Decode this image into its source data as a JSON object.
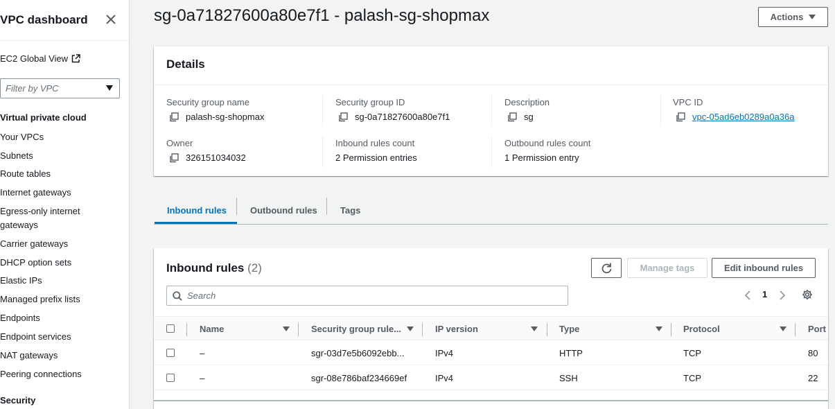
{
  "sidebar": {
    "title": "VPC dashboard",
    "global_view": "EC2 Global View",
    "filter_placeholder": "Filter by VPC",
    "section_vpc": "Virtual private cloud",
    "items": [
      "Your VPCs",
      "Subnets",
      "Route tables",
      "Internet gateways",
      "Egress-only internet gateways",
      "Carrier gateways",
      "DHCP option sets",
      "Elastic IPs",
      "Managed prefix lists",
      "Endpoints",
      "Endpoint services",
      "NAT gateways",
      "Peering connections"
    ],
    "section_security": "Security"
  },
  "header": {
    "title": "sg-0a71827600a80e7f1 - palash-sg-shopmax",
    "actions_label": "Actions"
  },
  "details": {
    "title": "Details",
    "fields": {
      "sg_name_label": "Security group name",
      "sg_name": "palash-sg-shopmax",
      "sg_id_label": "Security group ID",
      "sg_id": "sg-0a71827600a80e7f1",
      "description_label": "Description",
      "description": "sg",
      "vpc_id_label": "VPC ID",
      "vpc_id": "vpc-05ad6eb0289a0a36a",
      "owner_label": "Owner",
      "owner": "326151034032",
      "inbound_count_label": "Inbound rules count",
      "inbound_count": "2 Permission entries",
      "outbound_count_label": "Outbound rules count",
      "outbound_count": "1 Permission entry"
    }
  },
  "tabs": {
    "inbound": "Inbound rules",
    "outbound": "Outbound rules",
    "tags": "Tags",
    "active": "inbound"
  },
  "rules": {
    "title": "Inbound rules",
    "count": "(2)",
    "manage_tags": "Manage tags",
    "edit_inbound": "Edit inbound rules",
    "search_placeholder": "Search",
    "page": "1",
    "columns": [
      "Name",
      "Security group rule...",
      "IP version",
      "Type",
      "Protocol",
      "Port"
    ],
    "rows": [
      [
        "–",
        "sgr-03d7e5b6092ebb...",
        "IPv4",
        "HTTP",
        "TCP",
        "80"
      ],
      [
        "–",
        "sgr-08e786baf234669ef",
        "IPv4",
        "SSH",
        "TCP",
        "22"
      ]
    ]
  },
  "colors": {
    "accent": "#0073bb",
    "text": "#16191f",
    "muted": "#545b64",
    "background": "#f2f3f3"
  }
}
